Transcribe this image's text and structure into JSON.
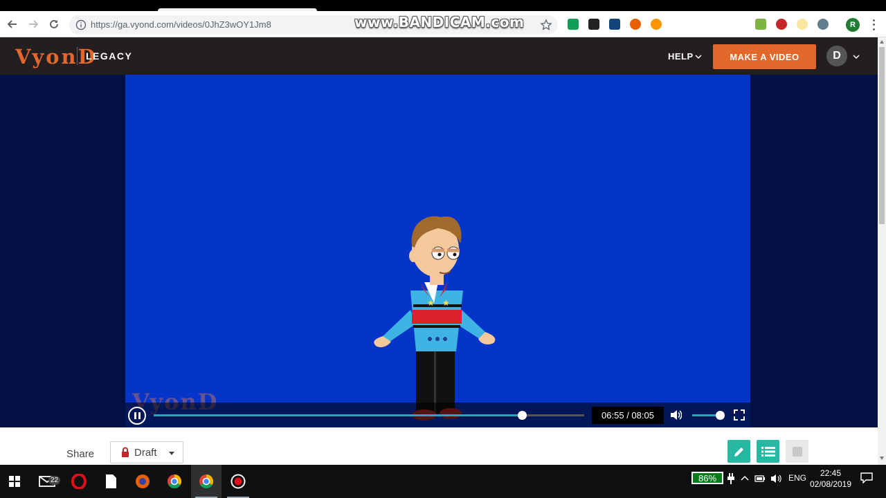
{
  "browser": {
    "url": "https://ga.vyond.com/videos/0JhZ3wOY1Jm8",
    "profile_initial": "R"
  },
  "overlay": {
    "watermark": "www.BANDICAM.com"
  },
  "site_header": {
    "logo": "VyonD",
    "product": "LEGACY",
    "help_label": "HELP",
    "make_video_label": "MAKE A VIDEO",
    "avatar_initial": "D",
    "accent_color": "#e2672b"
  },
  "player": {
    "video_watermark": "VyonD",
    "time_display": "06:55 / 08:05",
    "progress": 0.855,
    "volume": 0.87,
    "background_color": "#0434c8"
  },
  "footer": {
    "share_label": "Share",
    "status_label": "Draft",
    "actions": [
      "edit-icon",
      "list-icon",
      "square-icon"
    ]
  },
  "taskbar": {
    "mail_badge": "22",
    "battery": "86%",
    "language": "ENG",
    "time": "22:45",
    "date": "02/08/2019"
  }
}
